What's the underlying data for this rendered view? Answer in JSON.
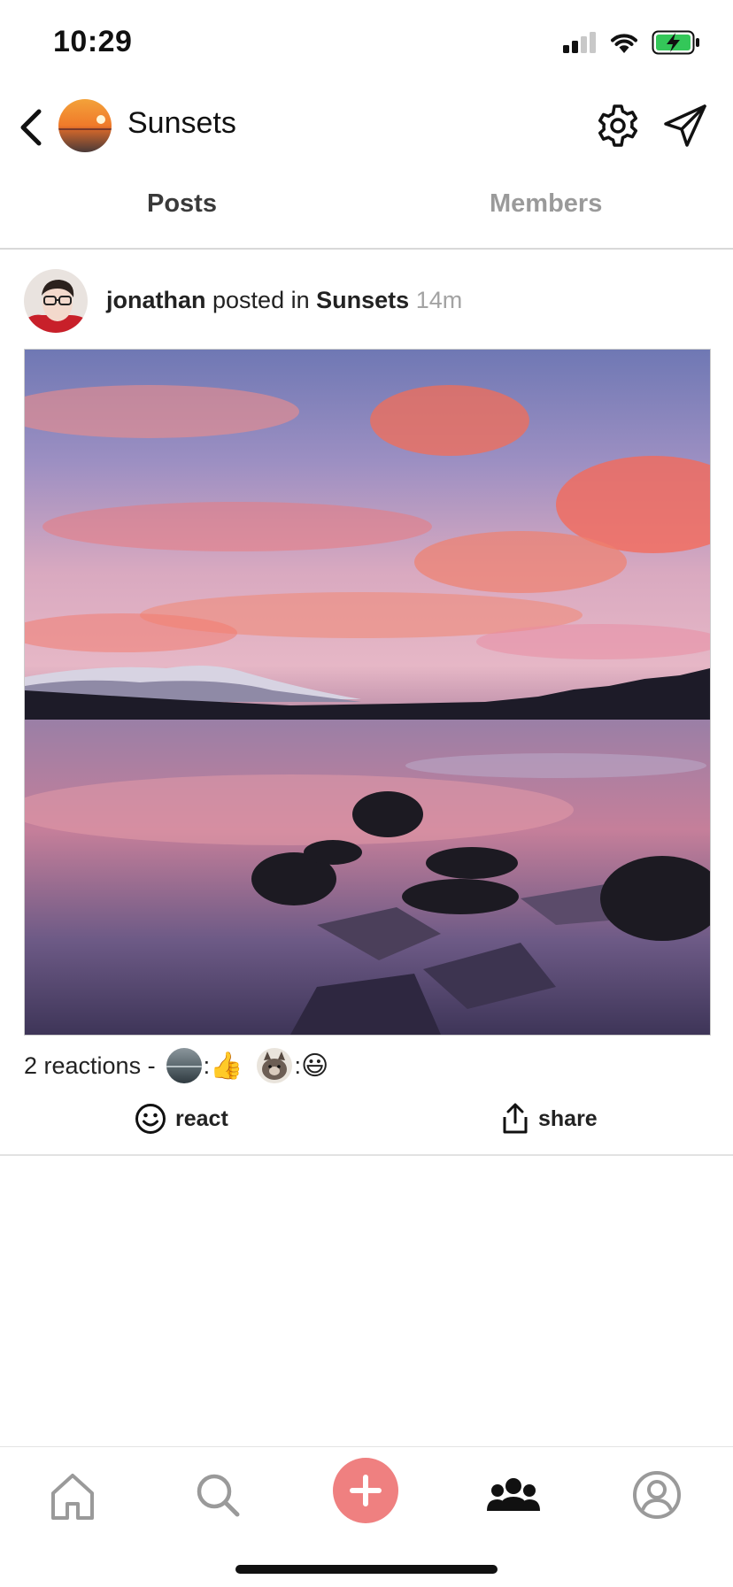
{
  "status_bar": {
    "time": "10:29"
  },
  "header": {
    "group_name": "Sunsets"
  },
  "tabs": [
    {
      "label": "Posts",
      "active": true
    },
    {
      "label": "Members",
      "active": false
    }
  ],
  "post": {
    "author": "jonathan",
    "action": "posted in",
    "group": "Sunsets",
    "time_ago": "14m",
    "reactions": {
      "count_text": "2 reactions -",
      "items": [
        {
          "avatar": "avatar-gray-circle",
          "emoji": "👍"
        },
        {
          "avatar": "avatar-cat",
          "emoji": "😃"
        }
      ]
    },
    "actions": {
      "react_label": "react",
      "share_label": "share"
    }
  },
  "tab_bar": {
    "items": [
      "home-icon",
      "search-icon",
      "add-icon",
      "groups-icon",
      "profile-icon"
    ],
    "accent_color": "#ef8080",
    "active": "groups-icon"
  }
}
